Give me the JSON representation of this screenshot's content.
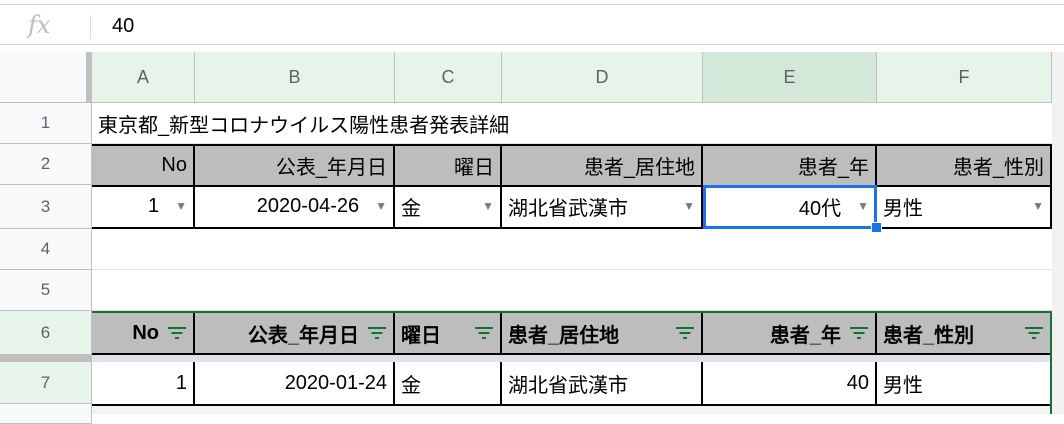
{
  "formula_bar": {
    "icon": "fx-icon",
    "label": "fx",
    "value": "40"
  },
  "columns": [
    "A",
    "B",
    "C",
    "D",
    "E",
    "F"
  ],
  "rows": [
    "1",
    "2",
    "3",
    "4",
    "5",
    "6",
    "7"
  ],
  "title": "東京都_新型コロナウイルス陽性患者発表詳細",
  "query_headers": [
    "No",
    "公表_年月日",
    "曜日",
    "患者_居住地",
    "患者_年",
    "患者_性別"
  ],
  "query_values": [
    "1",
    "2020-04-26",
    "金",
    "湖北省武漢市",
    "40代",
    "男性"
  ],
  "table_headers": [
    "No",
    "公表_年月日",
    "曜日",
    "患者_居住地",
    "患者_年",
    "患者_性別"
  ],
  "table_rows": [
    [
      "1",
      "2020-01-24",
      "金",
      "湖北省武漢市",
      "40",
      "男性"
    ]
  ],
  "colors": {
    "selection": "#1a73e8",
    "filter": "#137333",
    "header_fill": "#bdbdbd",
    "col_header": "#e6f4ea"
  }
}
